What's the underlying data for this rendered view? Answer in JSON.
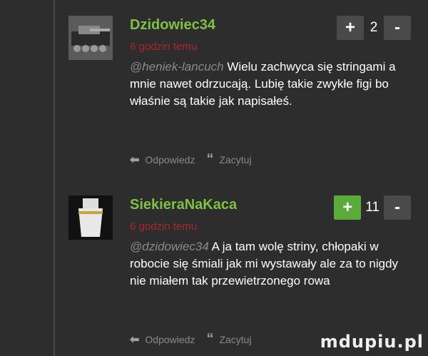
{
  "comments": [
    {
      "author": "Dzidowiec34",
      "time": "6 godzin temu",
      "votes": {
        "plus": "+",
        "count": "2",
        "minus": "-"
      },
      "mention": "@heniek-lancuch",
      "text": " Wielu zachwyca się stringami a mnie nawet odrzucają. Lubię takie zwykłe figi bo właśnie są takie jak napisałeś.",
      "reply_label": "Odpowiedz",
      "quote_label": "Zacytuj"
    },
    {
      "author": "SiekieraNaKaca",
      "time": "6 godzin temu",
      "votes": {
        "plus": "+",
        "count": "11",
        "minus": "-"
      },
      "mention": "@dzidowiec34",
      "text": " A ja tam wolę striny, chłopaki w robocie się śmiali jak mi wystawały ale za to nigdy nie miałem tak przewietrzonego rowa",
      "reply_label": "Odpowiedz",
      "quote_label": "Zacytuj"
    }
  ],
  "icons": {
    "reply": "reply-arrow-icon",
    "quote": "quote-marks-icon"
  },
  "colors": {
    "author": "#7dc242",
    "time": "#a8272d",
    "active_vote": "#5aaa3c"
  },
  "watermark": "mdupiu.pl"
}
